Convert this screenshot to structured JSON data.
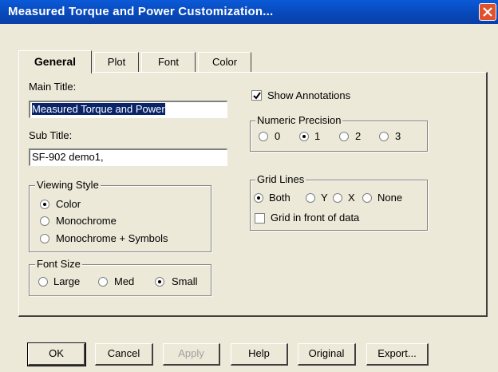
{
  "window": {
    "title": "Measured Torque and Power Customization..."
  },
  "tabs": [
    "General",
    "Plot",
    "Font",
    "Color"
  ],
  "main_title": {
    "label": "Main Title:",
    "value": "Measured Torque and Power"
  },
  "sub_title": {
    "label": "Sub Title:",
    "value": "SF-902 demo1,"
  },
  "viewing_style": {
    "label": "Viewing Style",
    "options": [
      "Color",
      "Monochrome",
      "Monochrome + Symbols"
    ],
    "selected": "Color"
  },
  "font_size": {
    "label": "Font Size",
    "options": [
      "Large",
      "Med",
      "Small"
    ],
    "selected": "Small"
  },
  "show_annotations": {
    "label": "Show Annotations",
    "checked": true
  },
  "numeric_precision": {
    "label": "Numeric Precision",
    "options": [
      "0",
      "1",
      "2",
      "3"
    ],
    "selected": "1"
  },
  "grid_lines": {
    "label": "Grid Lines",
    "options": [
      "Both",
      "Y",
      "X",
      "None"
    ],
    "selected": "Both",
    "front_label": "Grid in front of data",
    "front_checked": false
  },
  "buttons": {
    "ok": "OK",
    "cancel": "Cancel",
    "apply": "Apply",
    "help": "Help",
    "original": "Original",
    "export": "Export..."
  }
}
